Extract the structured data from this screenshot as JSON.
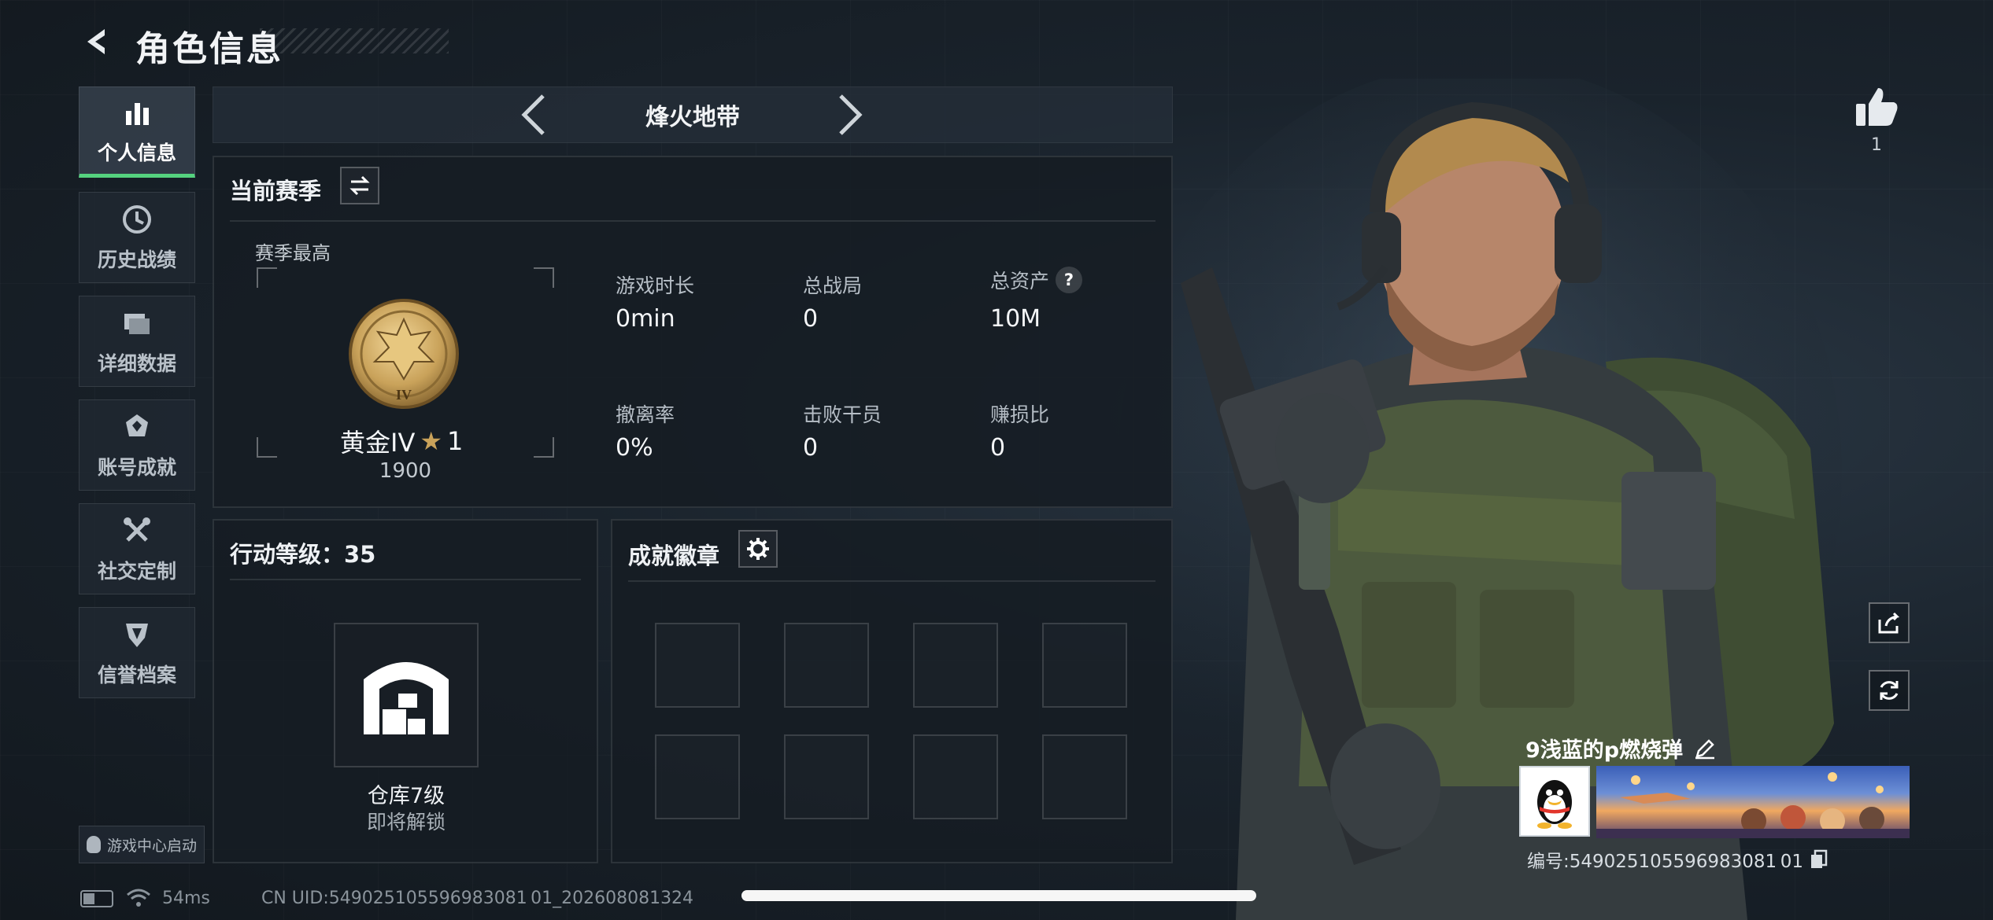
{
  "header": {
    "title": "角色信息"
  },
  "sidebar": {
    "items": [
      {
        "label": "个人信息",
        "icon": "bar-chart-icon",
        "active": true
      },
      {
        "label": "历史战绩",
        "icon": "clock-icon",
        "active": false
      },
      {
        "label": "详细数据",
        "icon": "folder-icon",
        "active": false
      },
      {
        "label": "账号成就",
        "icon": "achievement-icon",
        "active": false
      },
      {
        "label": "社交定制",
        "icon": "tools-icon",
        "active": false
      },
      {
        "label": "信誉档案",
        "icon": "credit-shield-icon",
        "active": false
      }
    ],
    "game_center": "游戏中心启动"
  },
  "mode_switcher": {
    "current": "烽火地带"
  },
  "season": {
    "title": "当前赛季",
    "best_label": "赛季最高",
    "rank_name": "黄金IV",
    "rank_stars": "1",
    "rank_points": "1900",
    "rank_badge_numeral": "IV",
    "stats": [
      {
        "label": "游戏时长",
        "value": "0min"
      },
      {
        "label": "总战局",
        "value": "0"
      },
      {
        "label": "总资产",
        "value": "10M",
        "help": "?"
      },
      {
        "label": "撤离率",
        "value": "0%"
      },
      {
        "label": "击败干员",
        "value": "0"
      },
      {
        "label": "赚损比",
        "value": "0"
      }
    ]
  },
  "action_level": {
    "title": "行动等级：35",
    "warehouse_level": "仓库7级",
    "warehouse_status": "即将解锁"
  },
  "badges": {
    "title": "成就徽章",
    "slot_count": 8
  },
  "profile": {
    "like_count": "1",
    "player_name": "9浅蓝的p燃烧弹",
    "player_id": "编号:549025105596983081 01"
  },
  "status": {
    "ping": "54ms",
    "uid": "CN UID:549025105596983081 01_202608081324"
  },
  "colors": {
    "accent_green": "#55d27f",
    "rank_gold": "#c9a25a",
    "panel_bg": "#161c23"
  }
}
